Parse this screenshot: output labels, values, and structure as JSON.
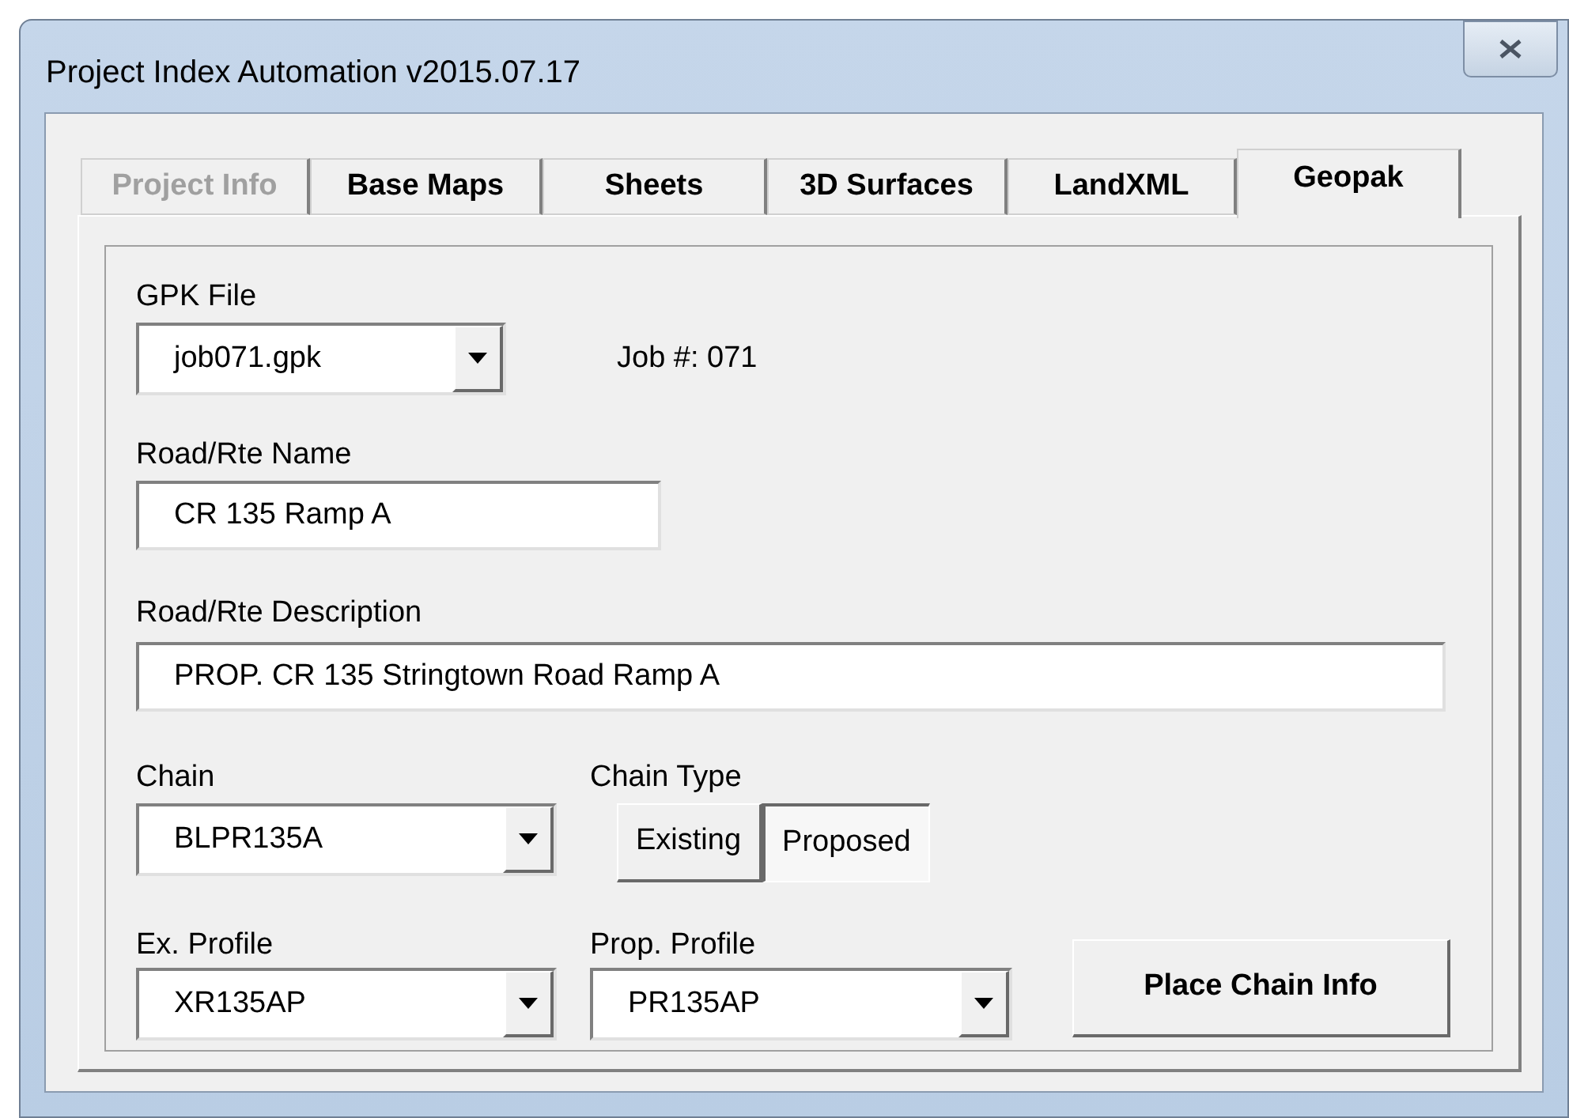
{
  "window": {
    "title": "Project Index Automation v2015.07.17"
  },
  "tabs": [
    {
      "label": "Project Info",
      "selected": false,
      "disabled": true
    },
    {
      "label": "Base Maps",
      "selected": false,
      "disabled": false
    },
    {
      "label": "Sheets",
      "selected": false,
      "disabled": false
    },
    {
      "label": "3D Surfaces",
      "selected": false,
      "disabled": false
    },
    {
      "label": "LandXML",
      "selected": false,
      "disabled": false
    },
    {
      "label": "Geopak",
      "selected": true,
      "disabled": false
    }
  ],
  "gpk_file": {
    "label": "GPK File",
    "value": "job071.gpk"
  },
  "job_number": "Job #: 071",
  "road_name": {
    "label": "Road/Rte Name",
    "value": "CR 135 Ramp A"
  },
  "road_description": {
    "label": "Road/Rte Description",
    "value": "PROP. CR 135 Stringtown Road Ramp A"
  },
  "chain": {
    "label": "Chain",
    "value": "BLPR135A"
  },
  "chain_type": {
    "label": "Chain Type",
    "options": [
      {
        "label": "Existing",
        "selected": false
      },
      {
        "label": "Proposed",
        "selected": true
      }
    ]
  },
  "ex_profile": {
    "label": "Ex. Profile",
    "value": "XR135AP"
  },
  "prop_profile": {
    "label": "Prop. Profile",
    "value": "PR135AP"
  },
  "button": {
    "label": "Place Chain Info"
  }
}
